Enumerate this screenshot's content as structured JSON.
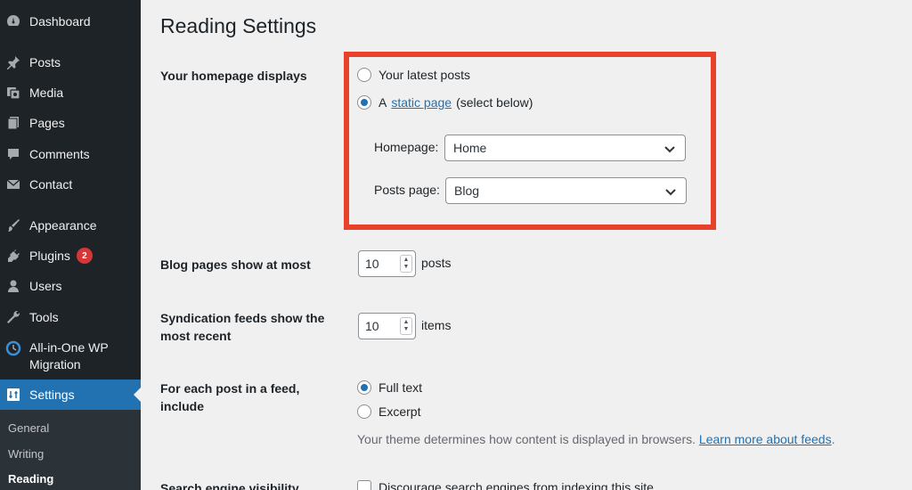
{
  "sidebar": {
    "items": [
      {
        "label": "Dashboard",
        "icon": "dashboard-icon"
      },
      {
        "label": "Posts",
        "icon": "pin-icon"
      },
      {
        "label": "Media",
        "icon": "media-icon"
      },
      {
        "label": "Pages",
        "icon": "pages-icon"
      },
      {
        "label": "Comments",
        "icon": "comments-icon"
      },
      {
        "label": "Contact",
        "icon": "mail-icon"
      },
      {
        "label": "Appearance",
        "icon": "paintbrush-icon"
      },
      {
        "label": "Plugins",
        "icon": "plugin-icon",
        "badge": "2"
      },
      {
        "label": "Users",
        "icon": "users-icon"
      },
      {
        "label": "Tools",
        "icon": "wrench-icon"
      },
      {
        "label": "All-in-One WP Migration",
        "icon": "migration-icon"
      },
      {
        "label": "Settings",
        "icon": "settings-icon"
      }
    ],
    "submenu": [
      {
        "label": "General"
      },
      {
        "label": "Writing"
      },
      {
        "label": "Reading"
      }
    ]
  },
  "main": {
    "title": "Reading Settings",
    "homepage": {
      "label": "Your homepage displays",
      "option_latest": "Your latest posts",
      "option_static_prefix": "A",
      "option_static_link": "static page",
      "option_static_suffix": "(select below)",
      "homepage_label": "Homepage:",
      "homepage_value": "Home",
      "posts_page_label": "Posts page:",
      "posts_page_value": "Blog"
    },
    "blog_pages": {
      "label": "Blog pages show at most",
      "value": "10",
      "unit": "posts"
    },
    "syndication": {
      "label": "Syndication feeds show the most recent",
      "value": "10",
      "unit": "items"
    },
    "feed_include": {
      "label": "For each post in a feed, include",
      "option_full": "Full text",
      "option_excerpt": "Excerpt",
      "desc_text": "Your theme determines how content is displayed in browsers.",
      "desc_link": "Learn more about feeds"
    },
    "search_visibility": {
      "label": "Search engine visibility",
      "checkbox_label": "Discourage search engines from indexing this site"
    }
  },
  "colors": {
    "sidebar_bg": "#1d2327",
    "accent": "#2271b1",
    "highlight": "#e8412c",
    "badge": "#d63638"
  }
}
